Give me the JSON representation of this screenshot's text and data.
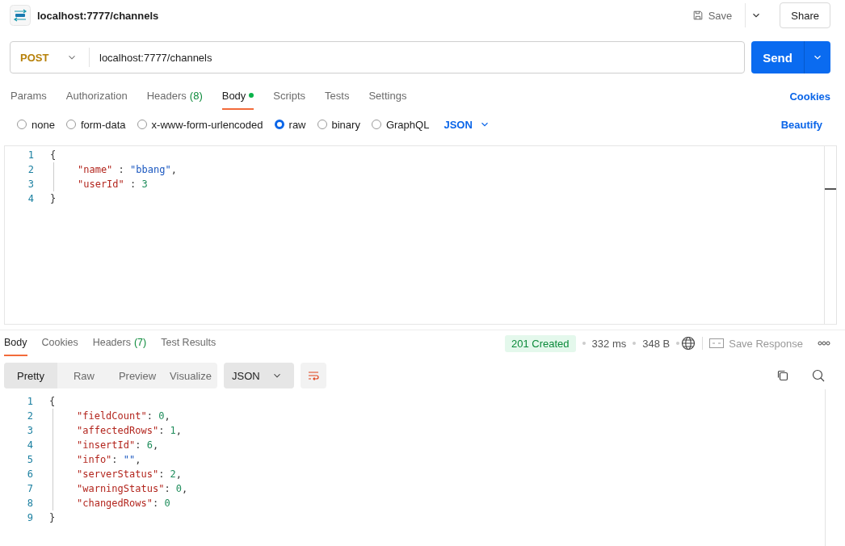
{
  "header": {
    "title": "localhost:7777/channels",
    "save": "Save",
    "share": "Share"
  },
  "request": {
    "method": "POST",
    "url": "localhost:7777/channels",
    "send": "Send"
  },
  "request_tabs": [
    {
      "label": "Params",
      "selected": false
    },
    {
      "label": "Authorization",
      "selected": false
    },
    {
      "label": "Headers",
      "count": "(8)",
      "selected": false
    },
    {
      "label": "Body",
      "dot": true,
      "selected": true
    },
    {
      "label": "Scripts",
      "selected": false
    },
    {
      "label": "Tests",
      "selected": false
    },
    {
      "label": "Settings",
      "selected": false
    }
  ],
  "cookies": "Cookies",
  "body_types": [
    {
      "label": "none",
      "selected": false
    },
    {
      "label": "form-data",
      "selected": false
    },
    {
      "label": "x-www-form-urlencoded",
      "selected": false
    },
    {
      "label": "raw",
      "selected": true
    },
    {
      "label": "binary",
      "selected": false
    },
    {
      "label": "GraphQL",
      "selected": false
    }
  ],
  "format": "JSON",
  "beautify": "Beautify",
  "request_body": [
    {
      "number": "1",
      "indented": false,
      "tokens": [
        {
          "kind": "punct",
          "text": "{"
        }
      ]
    },
    {
      "number": "2",
      "indented": true,
      "tokens": [
        {
          "kind": "key",
          "text": "\"name\""
        },
        {
          "kind": "punct",
          "text": " : "
        },
        {
          "kind": "string",
          "text": "\"bbang\""
        },
        {
          "kind": "punct",
          "text": ","
        }
      ]
    },
    {
      "number": "3",
      "indented": true,
      "tokens": [
        {
          "kind": "key",
          "text": "\"userId\""
        },
        {
          "kind": "punct",
          "text": " : "
        },
        {
          "kind": "number",
          "text": "3"
        }
      ]
    },
    {
      "number": "4",
      "indented": false,
      "tokens": [
        {
          "kind": "punct",
          "text": "}"
        }
      ]
    }
  ],
  "response_tabs": [
    {
      "label": "Body",
      "selected": true
    },
    {
      "label": "Cookies",
      "selected": false
    },
    {
      "label": "Headers",
      "count": "(7)",
      "selected": false
    },
    {
      "label": "Test Results",
      "selected": false
    }
  ],
  "status": {
    "code": "201 Created",
    "time": "332 ms",
    "size": "348 B",
    "save_response": "Save Response"
  },
  "view_modes": [
    {
      "label": "Pretty",
      "selected": true
    },
    {
      "label": "Raw",
      "selected": false
    },
    {
      "label": "Preview",
      "selected": false
    },
    {
      "label": "Visualize",
      "selected": false
    }
  ],
  "response_format": "JSON",
  "response_body": [
    {
      "number": "1",
      "indented": false,
      "tokens": [
        {
          "kind": "punct",
          "text": "{"
        }
      ]
    },
    {
      "number": "2",
      "indented": true,
      "tokens": [
        {
          "kind": "key",
          "text": "\"fieldCount\""
        },
        {
          "kind": "punct",
          "text": ": "
        },
        {
          "kind": "number",
          "text": "0"
        },
        {
          "kind": "punct",
          "text": ","
        }
      ]
    },
    {
      "number": "3",
      "indented": true,
      "tokens": [
        {
          "kind": "key",
          "text": "\"affectedRows\""
        },
        {
          "kind": "punct",
          "text": ": "
        },
        {
          "kind": "number",
          "text": "1"
        },
        {
          "kind": "punct",
          "text": ","
        }
      ]
    },
    {
      "number": "4",
      "indented": true,
      "tokens": [
        {
          "kind": "key",
          "text": "\"insertId\""
        },
        {
          "kind": "punct",
          "text": ": "
        },
        {
          "kind": "number",
          "text": "6"
        },
        {
          "kind": "punct",
          "text": ","
        }
      ]
    },
    {
      "number": "5",
      "indented": true,
      "tokens": [
        {
          "kind": "key",
          "text": "\"info\""
        },
        {
          "kind": "punct",
          "text": ": "
        },
        {
          "kind": "string",
          "text": "\"\""
        },
        {
          "kind": "punct",
          "text": ","
        }
      ]
    },
    {
      "number": "6",
      "indented": true,
      "tokens": [
        {
          "kind": "key",
          "text": "\"serverStatus\""
        },
        {
          "kind": "punct",
          "text": ": "
        },
        {
          "kind": "number",
          "text": "2"
        },
        {
          "kind": "punct",
          "text": ","
        }
      ]
    },
    {
      "number": "7",
      "indented": true,
      "tokens": [
        {
          "kind": "key",
          "text": "\"warningStatus\""
        },
        {
          "kind": "punct",
          "text": ": "
        },
        {
          "kind": "number",
          "text": "0"
        },
        {
          "kind": "punct",
          "text": ","
        }
      ]
    },
    {
      "number": "8",
      "indented": true,
      "tokens": [
        {
          "kind": "key",
          "text": "\"changedRows\""
        },
        {
          "kind": "punct",
          "text": ": "
        },
        {
          "kind": "number",
          "text": "0"
        }
      ]
    },
    {
      "number": "9",
      "indented": false,
      "tokens": [
        {
          "kind": "punct",
          "text": "}"
        }
      ]
    }
  ]
}
